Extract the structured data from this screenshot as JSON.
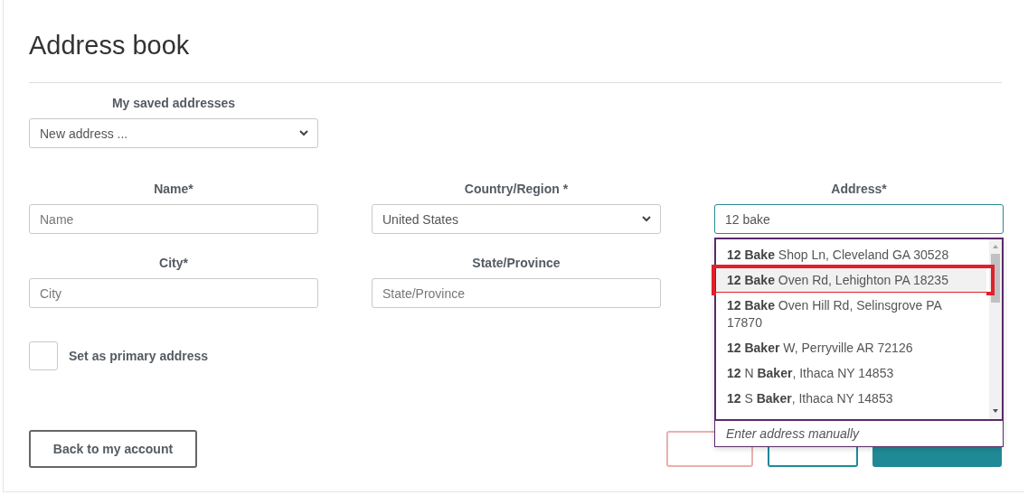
{
  "title": "Address book",
  "saved": {
    "label": "My saved addresses",
    "value": "New address ..."
  },
  "field_rows": [
    [
      {
        "label": "Name*",
        "kind": "input",
        "placeholder": "Name"
      },
      {
        "label": "Country/Region *",
        "kind": "select",
        "value": "United States"
      },
      {
        "label": "Address*",
        "kind": "input",
        "value": "12 bake",
        "focused": true,
        "suggestions": [
          {
            "text": "**12 Bake** Shop Ln, Cleveland GA 30528",
            "selected": false
          },
          {
            "text": "**12 Bake** Oven Rd, Lehighton PA 18235",
            "selected": true
          },
          {
            "text": "**12 Bake** Oven Hill Rd, Selinsgrove PA 17870",
            "selected": false
          },
          {
            "text": "**12 Baker** W, Perryville AR 72126",
            "selected": false
          },
          {
            "text": "**12** N **Baker**, Ithaca NY 14853",
            "selected": false
          },
          {
            "text": "**12** S **Baker**, Ithaca NY 14853",
            "selected": false
          }
        ],
        "manual_entry": "Enter address manually"
      }
    ],
    [
      {
        "label": "City*",
        "kind": "input",
        "placeholder": "City"
      },
      {
        "label": "State/Province",
        "kind": "input",
        "placeholder": "State/Province"
      }
    ]
  ],
  "primary": {
    "label": "Set as primary address",
    "checked": false
  },
  "back_button": "Back to my account",
  "action_buttons": [
    {
      "kind": "danger"
    },
    {
      "kind": "outline"
    },
    {
      "kind": "primary"
    }
  ]
}
